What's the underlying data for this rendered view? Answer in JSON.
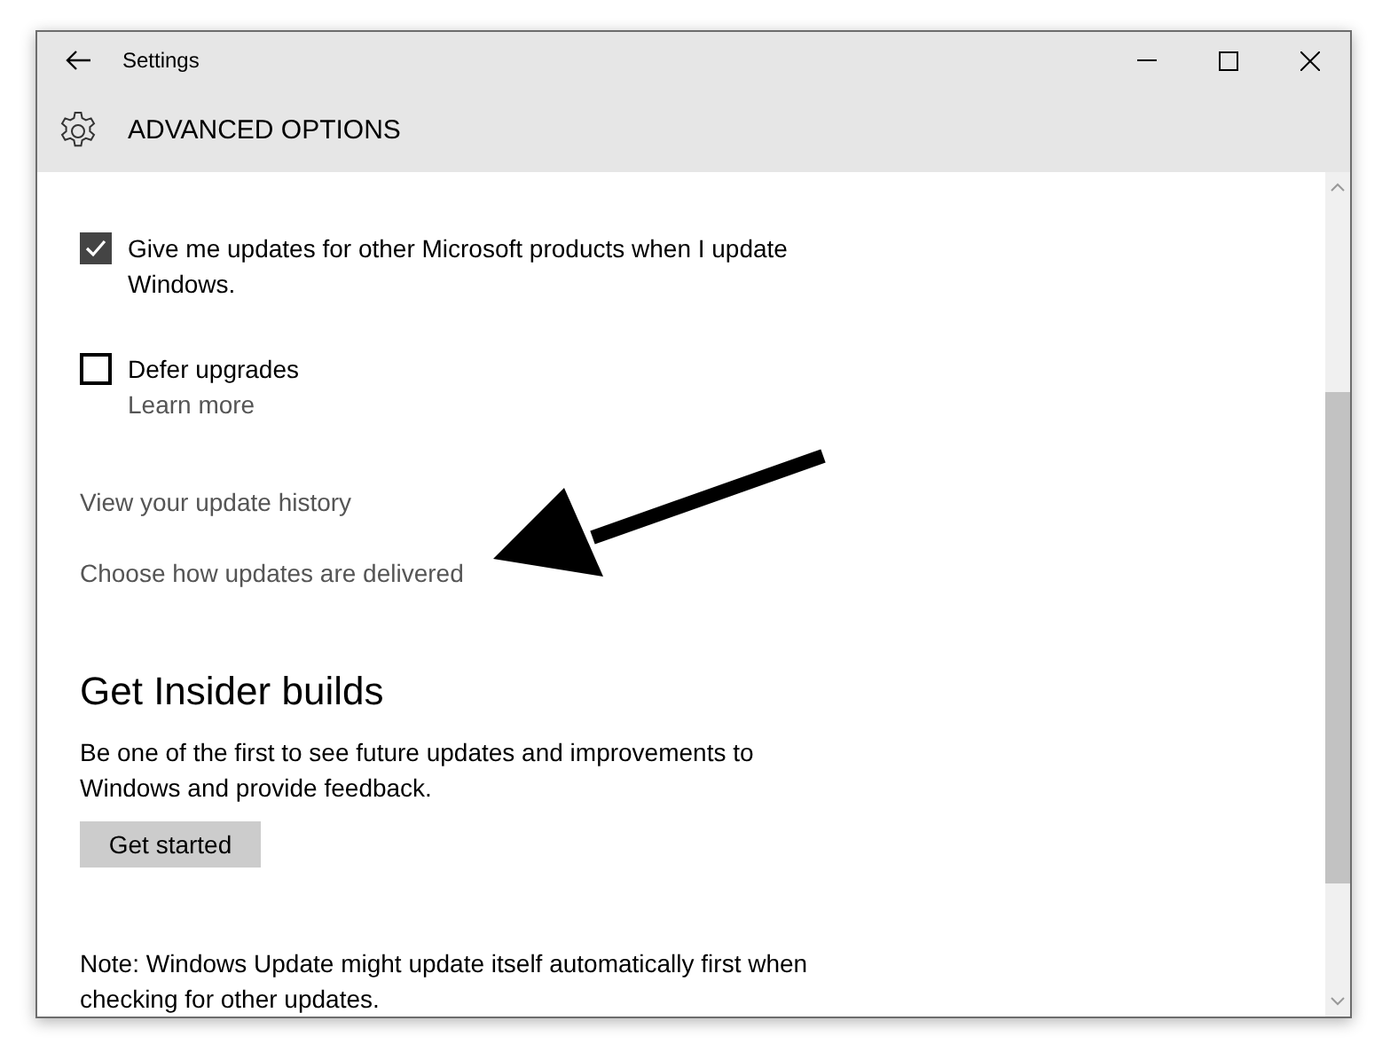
{
  "window": {
    "title": "Settings"
  },
  "header": {
    "title": "ADVANCED OPTIONS"
  },
  "options": [
    {
      "kind": "checkbox",
      "checked": true,
      "label": "Give me updates for other Microsoft products when I update Windows."
    },
    {
      "kind": "checkbox",
      "checked": false,
      "label": "Defer upgrades",
      "link": "Learn more"
    }
  ],
  "links": [
    "View your update history",
    "Choose how updates are delivered"
  ],
  "insider": {
    "heading": "Get Insider builds",
    "description": "Be one of the first to see future updates and improvements to Windows and provide feedback.",
    "button": "Get started"
  },
  "note": "Note: Windows Update might update itself automatically first when checking for other updates."
}
